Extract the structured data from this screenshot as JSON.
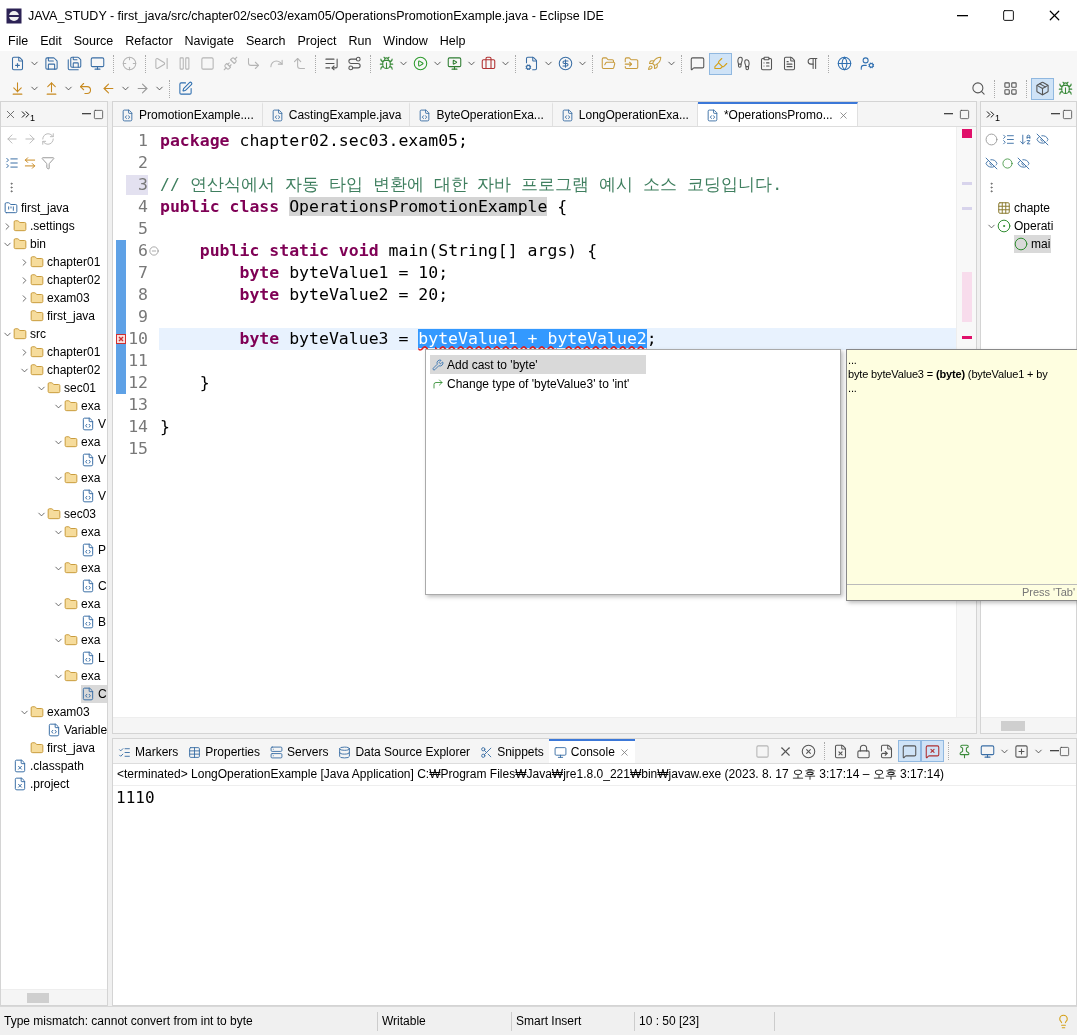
{
  "window": {
    "title": "JAVA_STUDY - first_java/src/chapter02/sec03/exam05/OperationsPromotionExample.java - Eclipse IDE"
  },
  "menu": [
    "File",
    "Edit",
    "Source",
    "Refactor",
    "Navigate",
    "Search",
    "Project",
    "Run",
    "Window",
    "Help"
  ],
  "toolbar": {
    "rows": [
      [
        {
          "kind": "file-plus",
          "dropdown": true,
          "on": false
        },
        {
          "kind": "save",
          "on": false
        },
        {
          "kind": "save-all",
          "on": false
        },
        {
          "kind": "monitor",
          "on": false
        },
        {
          "kind": "separator"
        },
        {
          "kind": "crosshair",
          "on": false
        },
        {
          "kind": "separator"
        },
        {
          "kind": "skip-forward",
          "on": false
        },
        {
          "kind": "pause",
          "on": false
        },
        {
          "kind": "square",
          "on": false
        },
        {
          "kind": "unplug",
          "on": false
        },
        {
          "kind": "corner-down-right",
          "on": false
        },
        {
          "kind": "redo",
          "on": false
        },
        {
          "kind": "corner-left-up",
          "on": false
        },
        {
          "kind": "separator"
        },
        {
          "kind": "list-end",
          "on": false
        },
        {
          "kind": "route",
          "on": false
        },
        {
          "kind": "separator"
        },
        {
          "kind": "bug",
          "dropdown": true,
          "on": false
        },
        {
          "kind": "circle-play",
          "dropdown": true,
          "on": false
        },
        {
          "kind": "monitor-play",
          "dropdown": true,
          "on": false
        },
        {
          "kind": "briefcase",
          "dropdown": true,
          "on": false
        },
        {
          "kind": "separator"
        },
        {
          "kind": "file-cog",
          "dropdown": true,
          "on": false
        },
        {
          "kind": "circle-dollar-sign",
          "dropdown": true,
          "on": false
        },
        {
          "kind": "separator"
        },
        {
          "kind": "folder-open",
          "on": false
        },
        {
          "kind": "folder-input",
          "on": false
        },
        {
          "kind": "rocket",
          "dropdown": true,
          "on": false
        },
        {
          "kind": "separator"
        },
        {
          "kind": "message-square",
          "on": false
        },
        {
          "kind": "highlighter",
          "on": true
        },
        {
          "kind": "footprints",
          "on": false
        },
        {
          "kind": "clipboard-list",
          "on": false
        },
        {
          "kind": "file-text",
          "on": false
        },
        {
          "kind": "pilcrow",
          "on": false
        },
        {
          "kind": "separator"
        },
        {
          "kind": "globe",
          "on": false
        },
        {
          "kind": "user-cog",
          "on": false
        }
      ],
      [
        {
          "kind": "arrow-down-to-line",
          "dropdown": true,
          "on": false
        },
        {
          "kind": "arrow-up-from-line",
          "dropdown": true,
          "on": false
        },
        {
          "kind": "undo",
          "on": false
        },
        {
          "kind": "arrow-left",
          "dropdown": true,
          "on": false
        },
        {
          "kind": "arrow-right",
          "dropdown": true,
          "on": false
        },
        {
          "kind": "separator"
        },
        {
          "kind": "square-pen",
          "on": false
        }
      ]
    ],
    "right": [
      {
        "kind": "search",
        "on": false
      },
      {
        "kind": "separator"
      },
      {
        "kind": "layout-grid",
        "on": false
      },
      {
        "kind": "separator"
      },
      {
        "kind": "package",
        "on": true
      },
      {
        "kind": "bug",
        "on": false
      }
    ]
  },
  "explorer": {
    "overflow_count": "1",
    "tree": [
      {
        "label": "first_java",
        "kind": "project",
        "selected": false,
        "children": [
          {
            "label": ".settings",
            "kind": "folder",
            "expanded": false,
            "selected": false
          },
          {
            "label": "bin",
            "kind": "folder",
            "expanded": true,
            "selected": false,
            "children": [
              {
                "label": "chapter01",
                "kind": "folder",
                "expanded": false,
                "selected": false
              },
              {
                "label": "chapter02",
                "kind": "folder",
                "expanded": false,
                "selected": false
              },
              {
                "label": "exam03",
                "kind": "folder",
                "expanded": false,
                "selected": false
              },
              {
                "label": "first_java",
                "kind": "folder",
                "selected": false
              }
            ]
          },
          {
            "label": "src",
            "kind": "folder",
            "expanded": true,
            "selected": false,
            "children": [
              {
                "label": "chapter01",
                "kind": "folder",
                "expanded": false,
                "selected": false
              },
              {
                "label": "chapter02",
                "kind": "folder",
                "expanded": true,
                "selected": false,
                "children": [
                  {
                    "label": "sec01",
                    "kind": "folder",
                    "expanded": true,
                    "selected": false,
                    "children": [
                      {
                        "label": "exa",
                        "kind": "folder",
                        "expanded": true,
                        "selected": false,
                        "children": [
                          {
                            "label": "V",
                            "kind": "java",
                            "selected": false
                          }
                        ]
                      },
                      {
                        "label": "exa",
                        "kind": "folder",
                        "expanded": true,
                        "selected": false,
                        "children": [
                          {
                            "label": "V",
                            "kind": "java",
                            "selected": false
                          }
                        ]
                      },
                      {
                        "label": "exa",
                        "kind": "folder",
                        "expanded": true,
                        "selected": false,
                        "children": [
                          {
                            "label": "V",
                            "kind": "java",
                            "selected": false
                          }
                        ]
                      }
                    ]
                  },
                  {
                    "label": "sec03",
                    "kind": "folder",
                    "expanded": true,
                    "selected": false,
                    "children": [
                      {
                        "label": "exa",
                        "kind": "folder",
                        "expanded": true,
                        "selected": false,
                        "children": [
                          {
                            "label": "P",
                            "kind": "java",
                            "selected": false
                          }
                        ]
                      },
                      {
                        "label": "exa",
                        "kind": "folder",
                        "expanded": true,
                        "selected": false,
                        "children": [
                          {
                            "label": "C",
                            "kind": "java",
                            "selected": false
                          }
                        ]
                      },
                      {
                        "label": "exa",
                        "kind": "folder",
                        "expanded": true,
                        "selected": false,
                        "children": [
                          {
                            "label": "B",
                            "kind": "java",
                            "selected": false
                          }
                        ]
                      },
                      {
                        "label": "exa",
                        "kind": "folder",
                        "expanded": true,
                        "selected": false,
                        "children": [
                          {
                            "label": "L",
                            "kind": "java",
                            "selected": false
                          }
                        ]
                      },
                      {
                        "label": "exa",
                        "kind": "folder",
                        "expanded": true,
                        "selected": false,
                        "children": [
                          {
                            "label": "C",
                            "kind": "java",
                            "selected": true
                          }
                        ]
                      }
                    ]
                  }
                ]
              },
              {
                "label": "exam03",
                "kind": "folder",
                "expanded": true,
                "selected": false,
                "children": [
                  {
                    "label": "Variable",
                    "kind": "java",
                    "selected": false
                  }
                ]
              },
              {
                "label": "first_java",
                "kind": "folder",
                "selected": false
              }
            ]
          },
          {
            "label": ".classpath",
            "kind": "xml",
            "selected": false
          },
          {
            "label": ".project",
            "kind": "xml",
            "selected": false
          }
        ]
      }
    ]
  },
  "editor_tabs": [
    {
      "label": "PromotionExample....",
      "selected": false
    },
    {
      "label": "CastingExample.java",
      "selected": false
    },
    {
      "label": "ByteOperationExa...",
      "selected": false
    },
    {
      "label": "LongOperationExa...",
      "selected": false
    },
    {
      "label": "*OperationsPromo...",
      "selected": true
    }
  ],
  "code": {
    "lines": [
      {
        "number": "1",
        "kind": "code",
        "text": "**package** chapter02.sec03.exam05;"
      },
      {
        "number": "2",
        "kind": "code"
      },
      {
        "number": "3",
        "kind": "comment",
        "number_marked": true,
        "text": "// 연산식에서 자동 타입 변환에 대한 자바 프로그램 예시 소스 코딩입니다."
      },
      {
        "number": "4",
        "kind": "code",
        "text": "**public** **class** ",
        "mark": {
          "text": "OperationsPromotionExample",
          "kind": "occurrence"
        },
        "after": " {"
      },
      {
        "number": "5",
        "kind": "code"
      },
      {
        "number": "6",
        "kind": "code",
        "folding": true,
        "changed": true,
        "text": "    **public** **static** **void** main(String[] args) {"
      },
      {
        "number": "7",
        "kind": "code",
        "changed": true,
        "text": "        **byte** byteValue1 = 10;"
      },
      {
        "number": "8",
        "kind": "code",
        "changed": true,
        "text": "        **byte** byteValue2 = 20;"
      },
      {
        "number": "9",
        "kind": "code",
        "changed": true
      },
      {
        "number": "10",
        "kind": "code",
        "changed": true,
        "error": true,
        "current": true,
        "text": "        **byte** byteValue3 = ",
        "mark": {
          "text": "byteValue1 + byteValue2",
          "kind": "selection"
        },
        "after": ";"
      },
      {
        "number": "11",
        "kind": "code",
        "changed": true
      },
      {
        "number": "12",
        "kind": "code",
        "changed": true,
        "text": "    }"
      },
      {
        "number": "13",
        "kind": "code"
      },
      {
        "number": "14",
        "kind": "code",
        "text": "}"
      },
      {
        "number": "15",
        "kind": "code"
      }
    ]
  },
  "quick_fix": {
    "proposals": [
      {
        "label": "Add cast to 'byte'",
        "kind": "cast",
        "selected": true
      },
      {
        "label": "Change type of 'byteValue3' to 'int'",
        "kind": "change",
        "selected": false
      }
    ],
    "preview": {
      "lines": [
        "...",
        "byte byteValue3 = **(byte)** (byteValue1 + by",
        "..."
      ],
      "footer": "Press 'Tab'"
    }
  },
  "outline": {
    "overflow_count": "1",
    "tree": [
      {
        "label": "chapte",
        "kind": "package",
        "selected": false
      },
      {
        "label": "Operati",
        "kind": "class",
        "expanded": true,
        "selected": false,
        "children": [
          {
            "label": "mai",
            "kind": "method",
            "selected": true
          }
        ]
      }
    ]
  },
  "console": {
    "tabs": [
      {
        "label": "Markers",
        "kind": "markers",
        "selected": false
      },
      {
        "label": "Properties",
        "kind": "properties",
        "selected": false
      },
      {
        "label": "Servers",
        "kind": "servers",
        "selected": false
      },
      {
        "label": "Data Source Explorer",
        "kind": "data-source",
        "selected": false
      },
      {
        "label": "Snippets",
        "kind": "snippets",
        "selected": false
      },
      {
        "label": "Console",
        "kind": "console",
        "selected": true
      }
    ],
    "tools": [
      {
        "kind": "square",
        "on": false
      },
      {
        "kind": "x",
        "on": false
      },
      {
        "kind": "circle-x",
        "on": false
      },
      {
        "kind": "separator"
      },
      {
        "kind": "file-x",
        "on": false
      },
      {
        "kind": "lock",
        "on": false
      },
      {
        "kind": "file-symlink",
        "on": false
      },
      {
        "kind": "message-square",
        "on": true
      },
      {
        "kind": "message-square-x",
        "on": true
      },
      {
        "kind": "separator"
      },
      {
        "kind": "pin",
        "on": false
      },
      {
        "kind": "monitor",
        "dropdown": true,
        "on": false
      },
      {
        "kind": "square-plus",
        "dropdown": true,
        "on": false
      }
    ],
    "header": "<terminated> LongOperationExample [Java Application] C:₩Program Files₩Java₩jre1.8.0_221₩bin₩javaw.exe  (2023. 8. 17 오후 3:17:14 – 오후 3:17:14)",
    "output": "1110"
  },
  "status_bar": [
    "Type mismatch: cannot convert from int to byte",
    "Writable",
    "Smart Insert",
    "10 : 50 [23]"
  ]
}
